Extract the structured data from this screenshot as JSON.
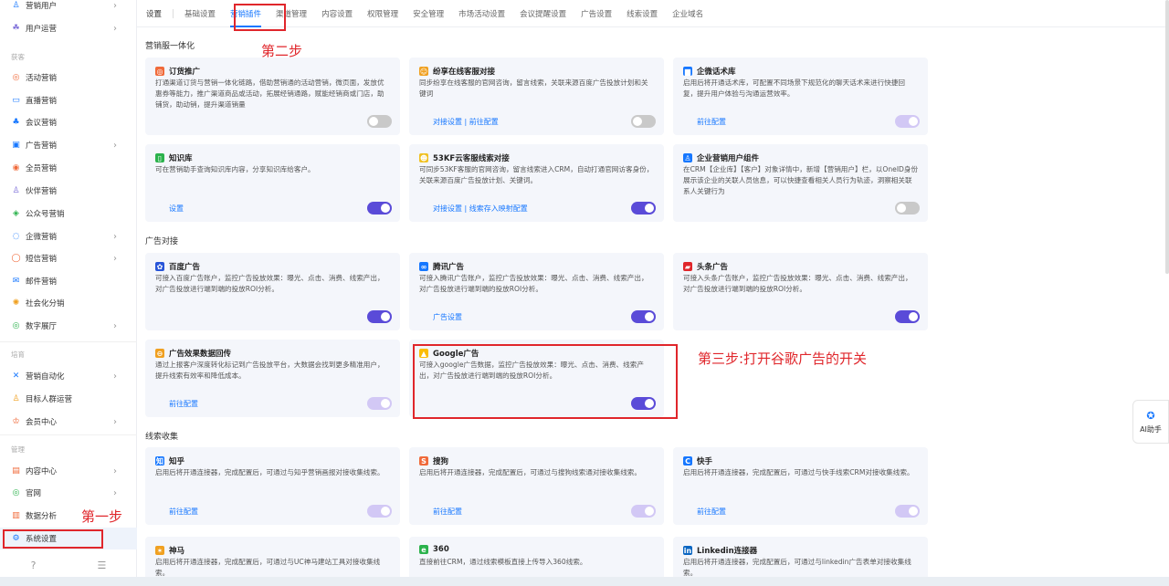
{
  "sidebar": {
    "items": [
      {
        "label": "营销用户",
        "icon": "user-icon",
        "glyph": "♙",
        "color": "#1677ff",
        "chevron": true
      },
      {
        "label": "用户运营",
        "icon": "users-icon",
        "glyph": "☘",
        "color": "#7a6bd8",
        "chevron": true
      },
      {
        "label": "活动营销",
        "icon": "activity-icon",
        "glyph": "◎",
        "color": "#f06a3a",
        "chevron": false
      },
      {
        "label": "直播营销",
        "icon": "live-icon",
        "glyph": "▭",
        "color": "#1677ff",
        "chevron": false
      },
      {
        "label": "会议营销",
        "icon": "meeting-icon",
        "glyph": "♣",
        "color": "#1677ff",
        "chevron": false
      },
      {
        "label": "广告营销",
        "icon": "ad-icon",
        "glyph": "▣",
        "color": "#1677ff",
        "chevron": true
      },
      {
        "label": "全员营销",
        "icon": "all-staff-icon",
        "glyph": "◉",
        "color": "#f06a3a",
        "chevron": false
      },
      {
        "label": "伙伴营销",
        "icon": "partner-icon",
        "glyph": "♙",
        "color": "#7a6bd8",
        "chevron": false
      },
      {
        "label": "公众号营销",
        "icon": "wechat-icon",
        "glyph": "◈",
        "color": "#2bb24c",
        "chevron": false
      },
      {
        "label": "企微营销",
        "icon": "wecom-icon",
        "glyph": "◌",
        "color": "#1677ff",
        "chevron": true
      },
      {
        "label": "短信营销",
        "icon": "sms-icon",
        "glyph": "◯",
        "color": "#f06a3a",
        "chevron": true
      },
      {
        "label": "邮件营销",
        "icon": "mail-icon",
        "glyph": "✉",
        "color": "#1677ff",
        "chevron": false
      },
      {
        "label": "社会化分销",
        "icon": "distribution-icon",
        "glyph": "✺",
        "color": "#f0a020",
        "chevron": false
      },
      {
        "label": "数字展厅",
        "icon": "showroom-icon",
        "glyph": "◎",
        "color": "#2bb24c",
        "chevron": true
      },
      {
        "label": "营销自动化",
        "icon": "automation-icon",
        "glyph": "✕",
        "color": "#1677ff",
        "chevron": true
      },
      {
        "label": "目标人群运营",
        "icon": "target-icon",
        "glyph": "♙",
        "color": "#f0a020",
        "chevron": false
      },
      {
        "label": "会员中心",
        "icon": "member-icon",
        "glyph": "♔",
        "color": "#f06a3a",
        "chevron": true
      },
      {
        "label": "内容中心",
        "icon": "content-icon",
        "glyph": "▤",
        "color": "#f06a3a",
        "chevron": true
      },
      {
        "label": "官网",
        "icon": "website-icon",
        "glyph": "◎",
        "color": "#2bb24c",
        "chevron": true
      },
      {
        "label": "数据分析",
        "icon": "analytics-icon",
        "glyph": "▥",
        "color": "#f06a3a",
        "chevron": true
      },
      {
        "label": "系统设置",
        "icon": "settings-icon",
        "glyph": "⚙",
        "color": "#1677ff",
        "chevron": false
      }
    ],
    "groups": {
      "acquire": "获客",
      "cultivate": "培育",
      "manage": "管理"
    },
    "footer": {
      "help": "?",
      "collapse": "☰"
    }
  },
  "tabs": {
    "first": "设置",
    "items": [
      "基础设置",
      "营销插件",
      "渠道管理",
      "内容设置",
      "权限管理",
      "安全管理",
      "市场活动设置",
      "会议提醒设置",
      "广告设置",
      "线索设置",
      "企业域名"
    ],
    "active_index": 1
  },
  "sections": {
    "integration": "营销服一体化",
    "ads": "广告对接",
    "leads": "线索收集"
  },
  "cards": [
    {
      "title": "订货推广",
      "icon": "order-promo-icon",
      "iconColor": "#f06a3a",
      "glyph": "◎",
      "desc": "打通渠道订货与营销一体化链路，借助营销通的活动营销，微页面，发放优惠券等能力，推广渠道商品或活动，拓展经销通路，赋能经销商或门店，助铺货，助动销，提升渠道销量",
      "link": "",
      "toggle": "off"
    },
    {
      "title": "纷享在线客服对接",
      "icon": "online-service-icon",
      "iconColor": "#f0a020",
      "glyph": "☺",
      "desc": "同步纷享在线客服的官网咨询，留言线索，关联来源百度广告投放计划和关键词",
      "link": "对接设置 | 前往配置",
      "toggle": "off"
    },
    {
      "title": "企微话术库",
      "icon": "script-library-icon",
      "iconColor": "#1677ff",
      "glyph": "▆",
      "desc": "启用后将开通话术库，可配置不同场景下规范化的聊天话术来进行快捷回复，提升用户体验与沟通运营效率。",
      "link": "前往配置",
      "toggle": "on-dim"
    },
    {
      "title": "知识库",
      "icon": "knowledge-base-icon",
      "iconColor": "#2bb24c",
      "glyph": "▯",
      "desc": "可在营销助手查询知识库内容，分享知识库给客户。",
      "link": "设置",
      "toggle": "on"
    },
    {
      "title": "53KF云客服线索对接",
      "icon": "kf53-icon",
      "iconColor": "#f0c020",
      "glyph": "☻",
      "desc": "可同步53KF客服的官网咨询，留言线索进入CRM，自动打通官网访客身份，关联来源百度广告投放计划、关键词。",
      "link": "对接设置 | 线索存入映射配置",
      "toggle": "on"
    },
    {
      "title": "企业营销用户组件",
      "icon": "marketing-user-component-icon",
      "iconColor": "#1677ff",
      "glyph": "♙",
      "desc": "在CRM【企业库】【客户】对象详情中，新增【营销用户】栏，以OneID身份展示该企业的关联人员信息，可以快捷查看相关人员行为轨迹，洞察相关联系人关键行为",
      "link": "",
      "toggle": "off"
    },
    {
      "title": "百度广告",
      "icon": "baidu-icon",
      "iconColor": "#2855d8",
      "glyph": "✿",
      "desc": "可接入百度广告账户，监控广告投放效果：曝光、点击、消费、线索产出，对广告投放进行端到端的投放ROI分析。",
      "link": "",
      "toggle": "on"
    },
    {
      "title": "腾讯广告",
      "icon": "tencent-icon",
      "iconColor": "#1677ff",
      "glyph": "∞",
      "desc": "可接入腾讯广告账户，监控广告投放效果：曝光、点击、消费、线索产出，对广告投放进行端到端的投放ROI分析。",
      "link": "广告设置",
      "toggle": "on"
    },
    {
      "title": "头条广告",
      "icon": "toutiao-icon",
      "iconColor": "#e0262b",
      "glyph": "▰",
      "desc": "可接入头条广告账户，监控广告投放效果：曝光、点击、消费、线索产出，对广告投放进行端到端的投放ROI分析。",
      "link": "",
      "toggle": "on"
    },
    {
      "title": "广告效果数据回传",
      "icon": "data-return-icon",
      "iconColor": "#f0a020",
      "glyph": "⊖",
      "desc": "通过上报客户深度转化标记到广告投放平台，大数据会找到更多精准用户，提升线索有效率和降低成本。",
      "link": "前往配置",
      "toggle": "on-dim"
    },
    {
      "title": "Google广告",
      "icon": "google-ads-icon",
      "iconColor": "#fbbc04",
      "glyph": "▲",
      "desc": "可接入google广告数据，监控广告投放效果：曝光、点击、消费、线索产出，对广告投放进行端到端的投放ROI分析。",
      "link": "",
      "toggle": "on"
    },
    {
      "title": "知乎",
      "icon": "zhihu-icon",
      "iconColor": "#1677ff",
      "glyph": "知",
      "desc": "启用后将开通连接器，完成配置后，可通过与知乎营销画报对接收集线索。",
      "link": "前往配置",
      "toggle": "on-dim"
    },
    {
      "title": "搜狗",
      "icon": "sogou-icon",
      "iconColor": "#f06a3a",
      "glyph": "S",
      "desc": "启用后将开通连接器，完成配置后，可通过与搜狗线索通对接收集线索。",
      "link": "前往配置",
      "toggle": "on-dim"
    },
    {
      "title": "快手",
      "icon": "kuaishou-icon",
      "iconColor": "#1677ff",
      "glyph": "C",
      "desc": "启用后将开通连接器，完成配置后，可通过与快手线索CRM对接收集线索。",
      "link": "前往配置",
      "toggle": "on-dim"
    },
    {
      "title": "神马",
      "icon": "shenma-icon",
      "iconColor": "#f0a020",
      "glyph": "✶",
      "desc": "启用后将开通连接器，完成配置后，可通过与UC神马建站工具对接收集线索。",
      "link": "",
      "toggle": ""
    },
    {
      "title": "360",
      "icon": "360-icon",
      "iconColor": "#2bb24c",
      "glyph": "e",
      "desc": "直接前往CRM，通过线索模板直接上传导入360线索。",
      "link": "",
      "toggle": ""
    },
    {
      "title": "Linkedin连接器",
      "icon": "linkedin-icon",
      "iconColor": "#0a66c2",
      "glyph": "in",
      "desc": "启用后将开通连接器，完成配置后，可通过与linkedin广告表单对接收集线索。",
      "link": "",
      "toggle": ""
    }
  ],
  "annotations": {
    "step1": "第一步",
    "step2": "第二步",
    "step3": "第三步:打开谷歌广告的开关"
  },
  "ai_helper": {
    "label": "AI助手"
  }
}
